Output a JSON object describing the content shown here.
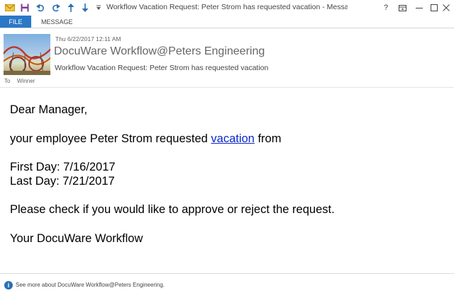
{
  "window": {
    "title": "Workflow Vacation Request: Peter Strom has requested vacation - Message (HTML)",
    "help": "?",
    "accent_color": "#2b78c6"
  },
  "quick_access": [
    "mail-icon",
    "save-icon",
    "undo-icon",
    "redo-icon",
    "up-arrow-icon",
    "down-arrow-icon",
    "customize-icon"
  ],
  "ribbon": {
    "tabs": [
      {
        "label": "FILE"
      },
      {
        "label": "MESSAGE"
      }
    ]
  },
  "header": {
    "datetime": "Thu 6/22/2017 12:11 AM",
    "sender": "DocuWare Workflow@Peters Engineering",
    "subject": "Workflow Vacation Request: Peter Strom has requested vacation",
    "to_label": "To",
    "to_value": "Winner"
  },
  "body": {
    "greeting": "Dear Manager,",
    "intro_before": "your employee Peter Strom requested ",
    "intro_link": "vacation",
    "intro_after": " from",
    "first_day": "First Day: 7/16/2017",
    "last_day": "Last Day: 7/21/2017",
    "request": "Please check if you would like to approve or reject the request.",
    "signature": "Your DocuWare Workflow",
    "link_color": "#0b27c8"
  },
  "footer": {
    "icon": "info-icon",
    "text": "See more about DocuWare Workflow@Peters Engineering."
  }
}
